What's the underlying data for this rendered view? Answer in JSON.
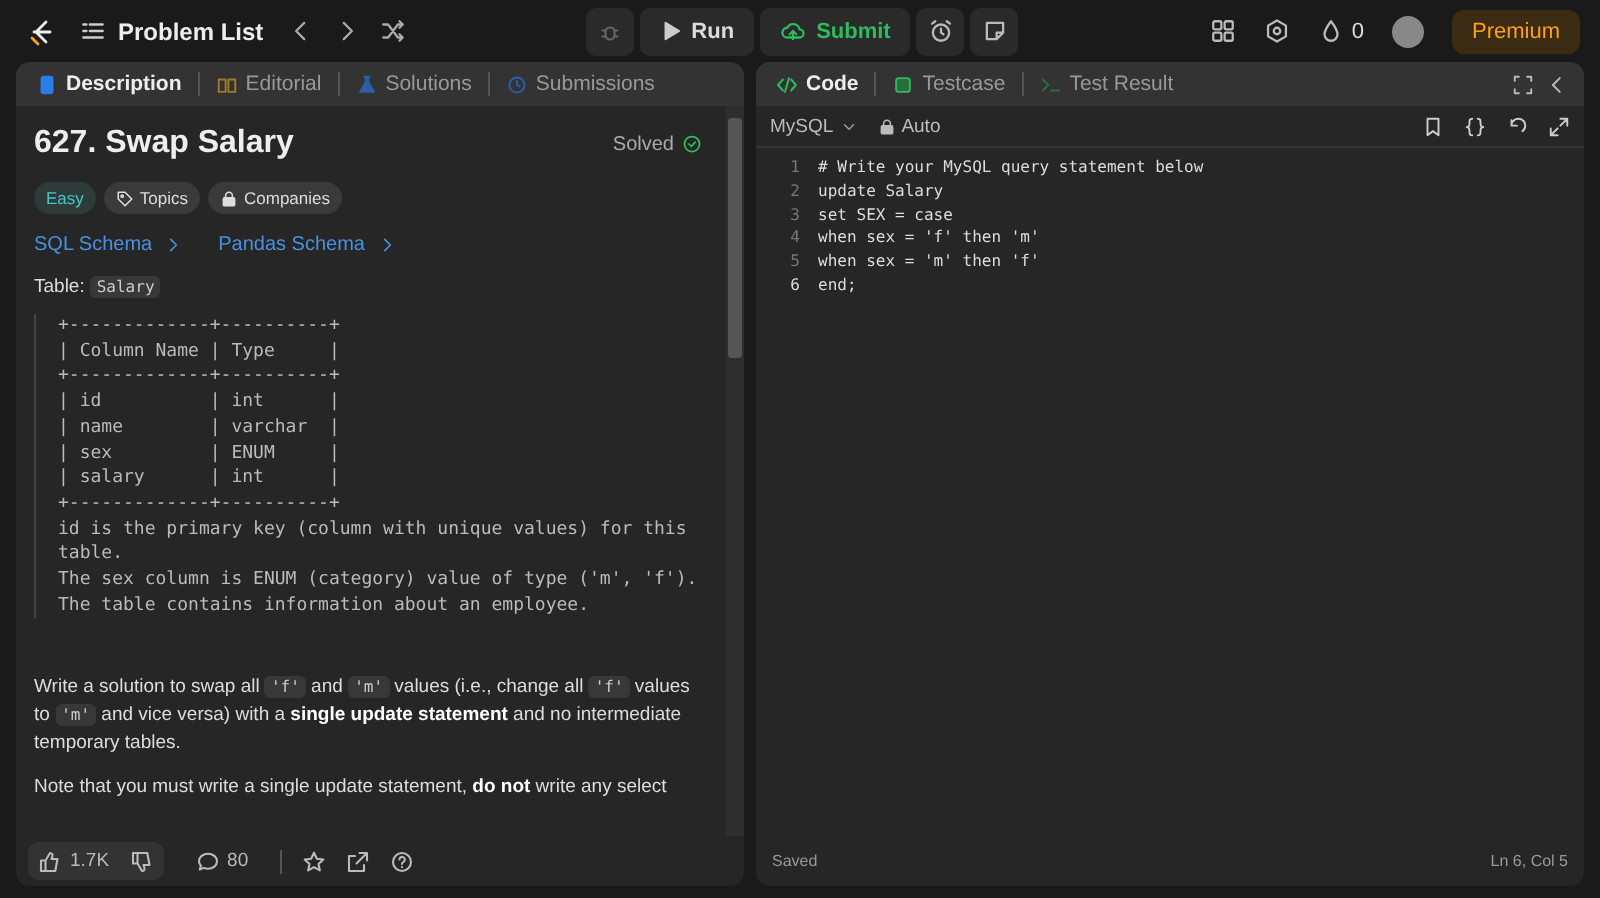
{
  "topbar": {
    "title": "Problem List",
    "run": "Run",
    "submit": "Submit",
    "streak": "0",
    "premium": "Premium"
  },
  "left_tabs": [
    {
      "label": "Description",
      "selected": true
    },
    {
      "label": "Editorial",
      "selected": false
    },
    {
      "label": "Solutions",
      "selected": false
    },
    {
      "label": "Submissions",
      "selected": false
    }
  ],
  "problem": {
    "title": "627. Swap Salary",
    "status": "Solved",
    "difficulty": "Easy",
    "tags": [
      "Topics",
      "Companies"
    ],
    "links": [
      "SQL Schema",
      "Pandas Schema"
    ],
    "table_label": "Table:",
    "table_name": "Salary",
    "schema_lines": [
      "+-------------+----------+",
      "| Column Name | Type     |",
      "+-------------+----------+",
      "| id          | int      |",
      "| name        | varchar  |",
      "| sex         | ENUM     |",
      "| salary      | int      |",
      "+-------------+----------+",
      "id is the primary key (column with unique values) for this",
      "table.",
      "The sex column is ENUM (category) value of type ('m', 'f').",
      "The table contains information about an employee."
    ],
    "paragraphs": [
      [
        {
          "kind": "text",
          "text": "Write a solution to swap all "
        },
        {
          "kind": "code",
          "text": "'f'"
        },
        {
          "kind": "text",
          "text": " and "
        },
        {
          "kind": "code",
          "text": "'m'"
        },
        {
          "kind": "text",
          "text": " values (i.e., change all "
        },
        {
          "kind": "code",
          "text": "'f'"
        },
        {
          "kind": "text",
          "text": " values to "
        },
        {
          "kind": "code",
          "text": "'m'"
        },
        {
          "kind": "text",
          "text": " and vice versa) with a "
        },
        {
          "kind": "bold",
          "text": "single update statement"
        },
        {
          "kind": "text",
          "text": " and no intermediate temporary tables."
        }
      ],
      [
        {
          "kind": "text",
          "text": "Note that you must write a single update statement, "
        },
        {
          "kind": "bold",
          "text": "do not"
        },
        {
          "kind": "text",
          "text": " write any select"
        }
      ]
    ]
  },
  "footer": {
    "likes": "1.7K",
    "comments": "80"
  },
  "right_tabs": [
    {
      "label": "Code",
      "selected": true
    },
    {
      "label": "Testcase",
      "selected": false
    },
    {
      "label": "Test Result",
      "selected": false
    }
  ],
  "editor": {
    "language": "MySQL",
    "mode": "Auto",
    "lines": [
      {
        "number": "1",
        "text": "# Write your MySQL query statement below"
      },
      {
        "number": "2",
        "text": "update Salary"
      },
      {
        "number": "3",
        "text": "set SEX = case"
      },
      {
        "number": "4",
        "text": "when sex = 'f' then 'm'"
      },
      {
        "number": "5",
        "text": "when sex = 'm' then 'f'"
      },
      {
        "number": "6",
        "text": "end;"
      }
    ],
    "status": "Saved",
    "cursor": "Ln 6, Col 5"
  }
}
